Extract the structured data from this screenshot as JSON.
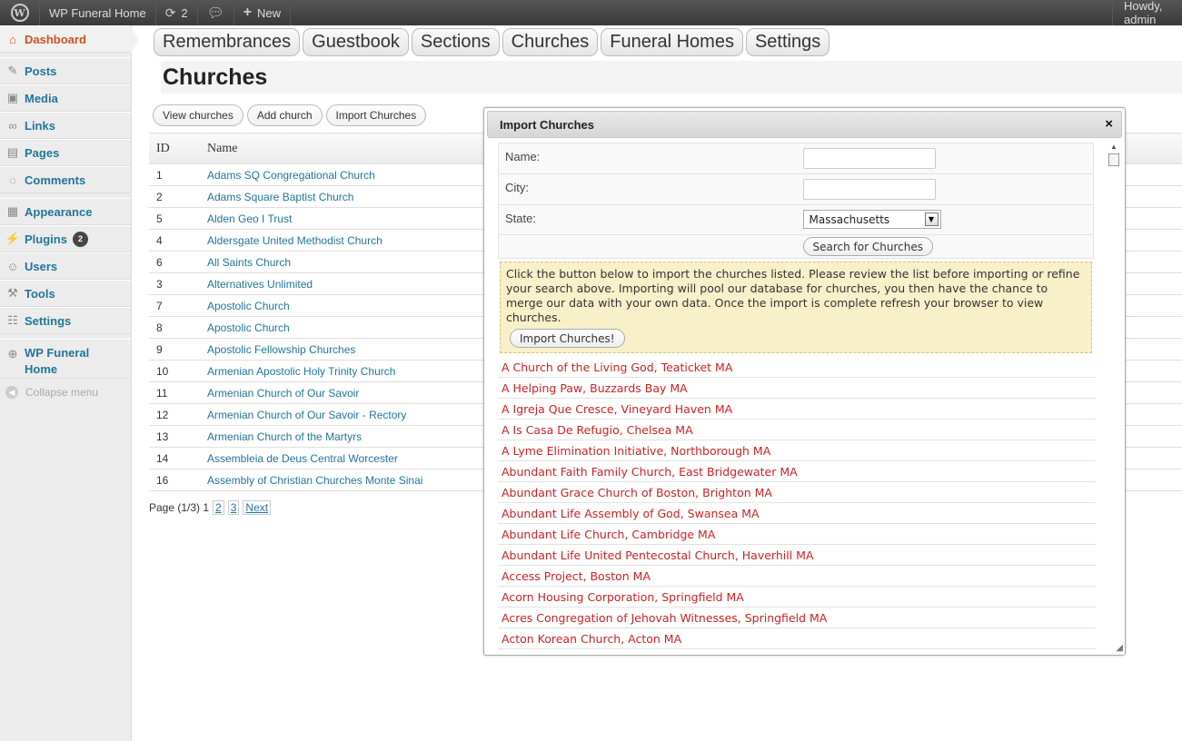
{
  "adminbar": {
    "site_name": "WP Funeral Home",
    "updates_count": "2",
    "new_label": "New",
    "howdy": "Howdy, admin"
  },
  "sidebar": {
    "items": [
      {
        "label": "Dashboard",
        "icon": "house-icon"
      },
      {
        "label": "Posts",
        "icon": "pushpin-icon"
      },
      {
        "label": "Media",
        "icon": "media-icon"
      },
      {
        "label": "Links",
        "icon": "link-icon"
      },
      {
        "label": "Pages",
        "icon": "pages-icon"
      },
      {
        "label": "Comments",
        "icon": "comment-icon"
      },
      {
        "label": "Appearance",
        "icon": "appearance-icon"
      },
      {
        "label": "Plugins",
        "icon": "plug-icon",
        "badge": "2"
      },
      {
        "label": "Users",
        "icon": "users-icon"
      },
      {
        "label": "Tools",
        "icon": "tools-icon"
      },
      {
        "label": "Settings",
        "icon": "settings-icon"
      },
      {
        "label": "WP Funeral Home",
        "label_line1": "WP Funeral",
        "label_line2": "Home",
        "icon": "globe-icon"
      }
    ],
    "collapse": "Collapse menu"
  },
  "plugin_tabs": [
    "Remembrances",
    "Guestbook",
    "Sections",
    "Churches",
    "Funeral Homes",
    "Settings"
  ],
  "page_title": "Churches",
  "subnav": [
    "View churches",
    "Add church",
    "Import Churches"
  ],
  "table": {
    "headers": [
      "ID",
      "Name"
    ],
    "rows": [
      {
        "id": "1",
        "name": "Adams SQ Congregational Church"
      },
      {
        "id": "2",
        "name": "Adams Square Baptist Church"
      },
      {
        "id": "5",
        "name": "Alden Geo I Trust"
      },
      {
        "id": "4",
        "name": "Aldersgate United Methodist Church"
      },
      {
        "id": "6",
        "name": "All Saints Church"
      },
      {
        "id": "3",
        "name": "Alternatives Unlimited"
      },
      {
        "id": "7",
        "name": "Apostolic Church"
      },
      {
        "id": "8",
        "name": "Apostolic Church"
      },
      {
        "id": "9",
        "name": "Apostolic Fellowship Churches"
      },
      {
        "id": "10",
        "name": "Armenian Apostolic Holy Trinity Church"
      },
      {
        "id": "11",
        "name": "Armenian Church of Our Savoir"
      },
      {
        "id": "12",
        "name": "Armenian Church of Our Savoir - Rectory"
      },
      {
        "id": "13",
        "name": "Armenian Church of the Martyrs"
      },
      {
        "id": "14",
        "name": "Assembleia de Deus Central Worcester"
      },
      {
        "id": "16",
        "name": "Assembly of Christian Churches Monte Sinai"
      }
    ]
  },
  "pager": {
    "text": "Page (1/3) 1",
    "links": [
      "2",
      "3",
      "Next"
    ]
  },
  "dialog": {
    "title": "Import Churches",
    "close": "×",
    "fields": {
      "name_label": "Name:",
      "name_value": "",
      "city_label": "City:",
      "city_value": "",
      "state_label": "State:",
      "state_value": "Massachusetts"
    },
    "search_button": "Search for Churches",
    "notice": "Click the button below to import the churches listed. Please review the list before importing or refine your search above. Importing will pool our database for churches, you then have the chance to merge our data with your own data. Once the import is complete refresh your browser to view churches.",
    "import_button": "Import Churches!",
    "results": [
      "A Church of the Living God, Teaticket MA",
      "A Helping Paw, Buzzards Bay MA",
      "A Igreja Que Cresce, Vineyard Haven MA",
      "A Is Casa De Refugio, Chelsea MA",
      "A Lyme Elimination Initiative, Northborough MA",
      "Abundant Faith Family Church, East Bridgewater MA",
      "Abundant Grace Church of Boston, Brighton MA",
      "Abundant Life Assembly of God, Swansea MA",
      "Abundant Life Church, Cambridge MA",
      "Abundant Life United Pentecostal Church, Haverhill MA",
      "Access Project, Boston MA",
      "Acorn Housing Corporation, Springfield MA",
      "Acres Congregation of Jehovah Witnesses, Springfield MA",
      "Acton Korean Church, Acton MA"
    ]
  }
}
